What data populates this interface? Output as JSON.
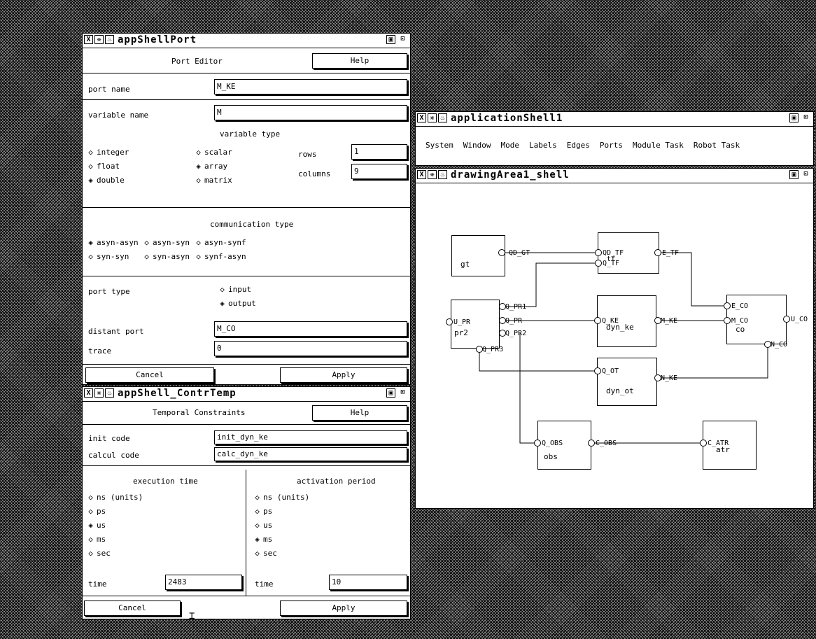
{
  "port_editor": {
    "title": "appShellPort",
    "header": "Port  Editor",
    "help": "Help",
    "port_name_label": "port name",
    "port_name_value": "M_KE",
    "variable_name_label": "variable name",
    "variable_name_value": "M",
    "variable_type_label": "variable type",
    "types_col1": [
      "integer",
      "float",
      "double"
    ],
    "types_col1_selected": [
      false,
      false,
      true
    ],
    "types_col2": [
      "scalar",
      "array",
      "matrix"
    ],
    "types_col2_selected": [
      false,
      true,
      false
    ],
    "rows_label": "rows",
    "rows_value": "1",
    "columns_label": "columns",
    "columns_value": "9",
    "comm_type_label": "communication type",
    "comm_row1": [
      "asyn-asyn",
      "asyn-syn",
      "asyn-synf"
    ],
    "comm_row1_selected": [
      true,
      false,
      false
    ],
    "comm_row2": [
      "syn-syn",
      "syn-asyn",
      "synf-asyn"
    ],
    "comm_row2_selected": [
      false,
      false,
      false
    ],
    "port_type_label": "port type",
    "port_type_options": [
      "input",
      "output"
    ],
    "port_type_selected": [
      false,
      true
    ],
    "distant_port_label": "distant port",
    "distant_port_value": "M_CO",
    "trace_label": "trace",
    "trace_value": "0",
    "cancel": "Cancel",
    "apply": "Apply"
  },
  "contr_temp": {
    "title": "appShell_ContrTemp",
    "header": "Temporal  Constraints",
    "help": "Help",
    "init_code_label": "init code",
    "init_code_value": "init_dyn_ke",
    "calcul_code_label": "calcul code",
    "calcul_code_value": "calc_dyn_ke",
    "exec_label": "execution time",
    "act_label": "activation period",
    "units": [
      "ns  (units)",
      "ps",
      "us",
      "ms",
      "sec"
    ],
    "exec_selected": [
      false,
      false,
      true,
      false,
      false
    ],
    "act_selected": [
      false,
      false,
      false,
      true,
      false
    ],
    "time_label": "time",
    "exec_time": "2483",
    "act_time": "10",
    "cancel": "Cancel",
    "apply": "Apply"
  },
  "app_shell": {
    "title": "applicationShell1",
    "menu": [
      "System",
      "Window",
      "Mode",
      "Labels",
      "Edges",
      "Ports",
      "Module Task",
      "Robot Task"
    ]
  },
  "drawing": {
    "title": "drawingArea1_shell",
    "tf_label": "tf",
    "nodes": [
      {
        "id": "gt",
        "name": "gt"
      },
      {
        "id": "tf",
        "name": ""
      },
      {
        "id": "pr2",
        "name": "pr2"
      },
      {
        "id": "dyn_ke",
        "name": "dyn_ke"
      },
      {
        "id": "co",
        "name": "co"
      },
      {
        "id": "dyn_ot",
        "name": "dyn_ot"
      },
      {
        "id": "obs",
        "name": "obs"
      },
      {
        "id": "atr",
        "name": "atr"
      }
    ],
    "ports": [
      "QD_GT",
      "QD_TF",
      "Q_TF",
      "E_TF",
      "Q_PR1",
      "U_PR",
      "Q_PR",
      "Q_PR2",
      "Q_PR3",
      "Q_KE",
      "M_KE",
      "E_CO",
      "M_CO",
      "U_CO",
      "N_CO",
      "Q_OT",
      "N_KE",
      "Q_OBS",
      "C_OBS",
      "C_ATR"
    ]
  }
}
